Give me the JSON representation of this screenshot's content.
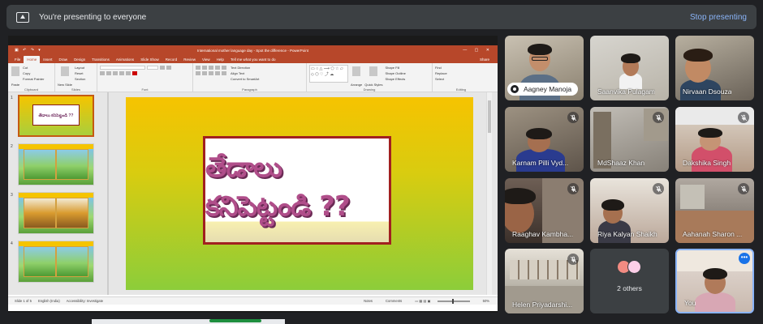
{
  "banner": {
    "message": "You're presenting to everyone",
    "stop_label": "Stop presenting"
  },
  "powerpoint": {
    "window_title": "International mother language day - Spot the difference - PowerPoint",
    "user": "Abhijit",
    "tabs": [
      "File",
      "Home",
      "Insert",
      "Draw",
      "Design",
      "Transitions",
      "Animations",
      "Slide Show",
      "Record",
      "Review",
      "View",
      "Help"
    ],
    "tell_me": "Tell me what you want to do",
    "share": "Share",
    "groups": [
      "Clipboard",
      "Slides",
      "Font",
      "Paragraph",
      "Drawing",
      "Editing"
    ],
    "clipboard_items": [
      "Cut",
      "Copy",
      "Format Painter"
    ],
    "paste_label": "Paste",
    "slides_items": [
      "Layout",
      "Reset",
      "Section"
    ],
    "new_slide_label": "New Slide",
    "paragraph_items": [
      "Text Direction",
      "Align Text",
      "Convert to SmartArt"
    ],
    "drawing_items": [
      "Arrange",
      "Quick Styles",
      "Shape Fill",
      "Shape Outline",
      "Shape Effects"
    ],
    "editing_items": [
      "Find",
      "Replace",
      "Select"
    ],
    "slide_numbers": [
      "1",
      "2",
      "3",
      "4"
    ],
    "slide_title_text": "తేడాలు కనిపెట్టండి ??",
    "thumb1_text": "తేడాలు కనిపెట్టండి ??",
    "status": {
      "slide": "Slide 1 of 5",
      "language": "English (India)",
      "accessibility": "Accessibility: Investigate",
      "notes": "Notes",
      "comments": "Comments",
      "zoom": "50%"
    }
  },
  "participants": [
    {
      "name": "Aagney Manoja",
      "muted": false,
      "pill": true
    },
    {
      "name": "Saanvika Pulagam",
      "muted": false
    },
    {
      "name": "Nirvaan Dsouza",
      "muted": false
    },
    {
      "name": "Karnam Pilli Vyd...",
      "muted": true
    },
    {
      "name": "MdShaaz Khan",
      "muted": true
    },
    {
      "name": "Dakshika Singh",
      "muted": true
    },
    {
      "name": "Raaghav Kambha...",
      "muted": true
    },
    {
      "name": "Riya Kalyan Shaikh",
      "muted": true
    },
    {
      "name": "Aahanah Sharon ...",
      "muted": true
    },
    {
      "name": "Helen Priyadarshi...",
      "muted": true
    },
    {
      "name": "You",
      "muted": true
    }
  ],
  "others_label": "2 others",
  "avatar_colors": [
    "#f28b82",
    "#fdcfe8"
  ],
  "accent_color": "#8ab4f8",
  "ppt_brand_color": "#b7472a"
}
